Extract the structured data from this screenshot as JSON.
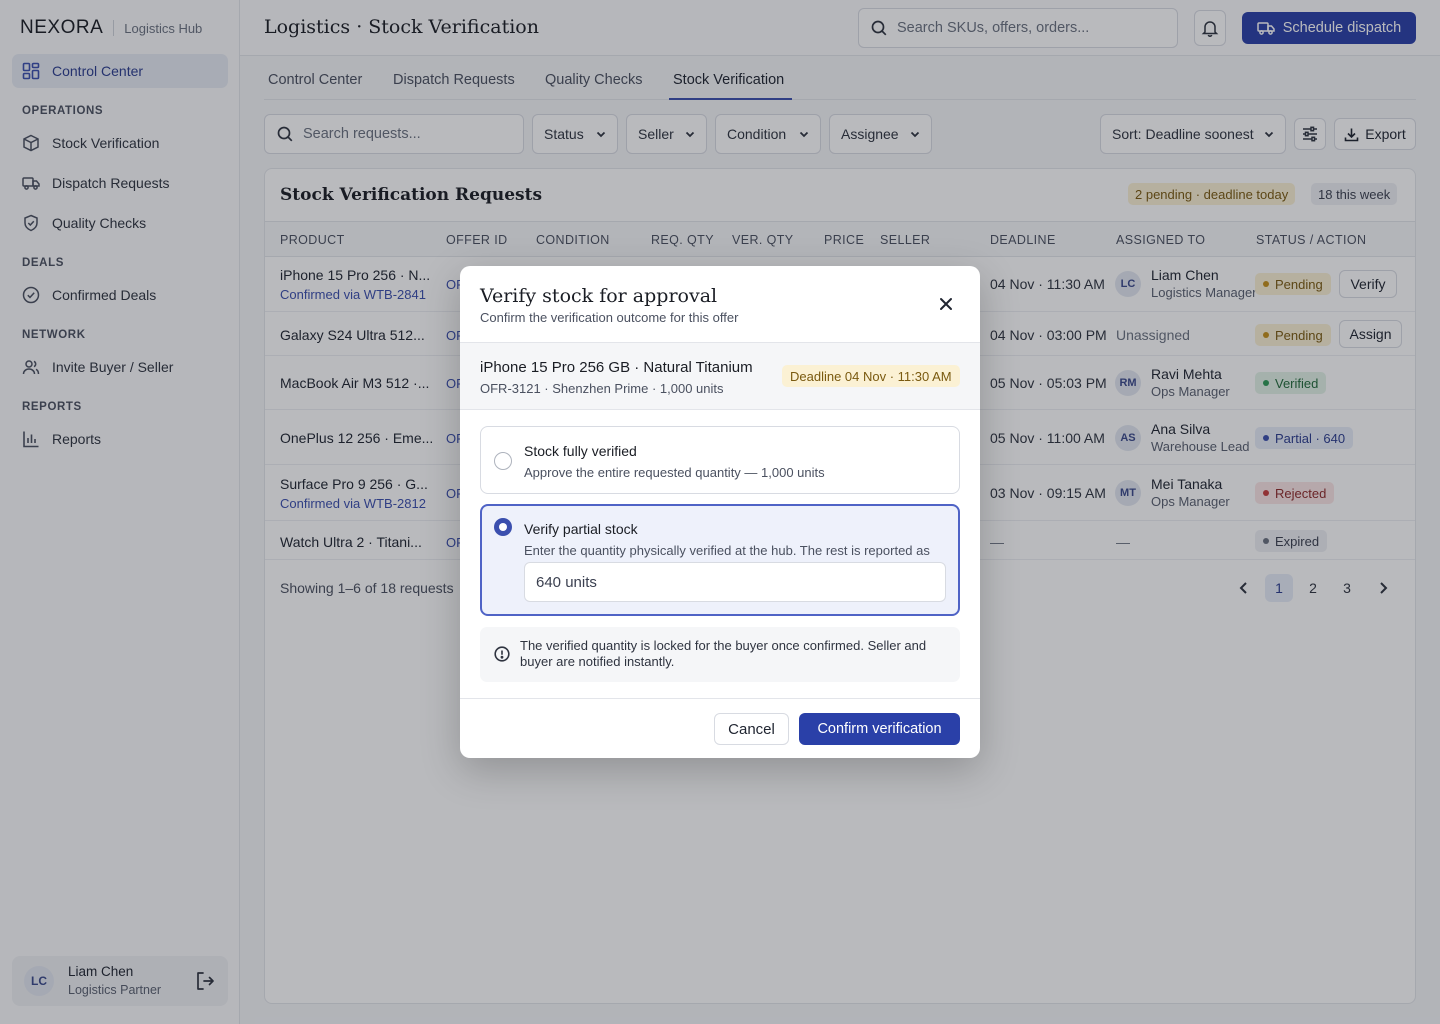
{
  "sidebar": {
    "brand": "NEXORA",
    "brand_sub": "Logistics Hub",
    "active_item": "Control Center",
    "sections": [
      {
        "label": "OPERATIONS",
        "items": [
          "Stock Verification",
          "Dispatch Requests",
          "Quality Checks"
        ]
      },
      {
        "label": "DEALS",
        "items": [
          "Confirmed Deals"
        ]
      },
      {
        "label": "NETWORK",
        "items": [
          "Invite Buyer / Seller"
        ]
      },
      {
        "label": "REPORTS",
        "items": [
          "Reports"
        ]
      }
    ],
    "user": {
      "initials": "LC",
      "name": "Liam Chen",
      "role": "Logistics Partner"
    }
  },
  "header": {
    "title": "Logistics · Stock Verification",
    "search_placeholder": "Search SKUs, offers, orders...",
    "dispatch_label": "Schedule dispatch"
  },
  "tabs": [
    {
      "label": "Control Center"
    },
    {
      "label": "Dispatch Requests"
    },
    {
      "label": "Quality Checks"
    },
    {
      "label": "Stock Verification",
      "active": true
    }
  ],
  "filters": {
    "search_placeholder": "Search requests...",
    "status": "Status",
    "seller": "Seller",
    "condition": "Condition",
    "assignee": "Assignee",
    "sort": "Sort: Deadline soonest",
    "export": "Export"
  },
  "panel": {
    "title": "Stock Verification Requests",
    "chip_pending": "2 pending · deadline today",
    "chip_week": "18 this week"
  },
  "table": {
    "columns": [
      "PRODUCT",
      "OFFER ID",
      "CONDITION",
      "REQ. QTY",
      "VER. QTY",
      "PRICE",
      "SELLER",
      "DEADLINE",
      "ASSIGNED TO",
      "STATUS / ACTION"
    ],
    "rows": [
      {
        "product": "iPhone 15 Pro 256 · N...",
        "sub": "Confirmed via WTB-2841",
        "offer": "OF",
        "deadline": "04 Nov · 11:30 AM",
        "initials": "LC",
        "assignee": "Liam Chen",
        "role": "Logistics Manager",
        "status": "Pending",
        "action": "Verify"
      },
      {
        "product": "Galaxy S24 Ultra 512...",
        "sub": "",
        "offer": "OF",
        "deadline": "04 Nov · 03:00 PM",
        "initials": "",
        "assignee": "Unassigned",
        "role": "",
        "status": "Pending",
        "action": "Assign"
      },
      {
        "product": "MacBook Air M3 512 ·...",
        "sub": "",
        "offer": "OF",
        "deadline": "05 Nov · 05:03 PM",
        "initials": "RM",
        "assignee": "Ravi Mehta",
        "role": "Ops Manager",
        "status": "Verified",
        "action": ""
      },
      {
        "product": "OnePlus 12 256 · Eme...",
        "sub": "",
        "offer": "OF",
        "deadline": "05 Nov · 11:00 AM",
        "initials": "AS",
        "assignee": "Ana Silva",
        "role": "Warehouse Lead",
        "status": "Partial · 640",
        "action": ""
      },
      {
        "product": "Surface Pro 9 256 · G...",
        "sub": "Confirmed via WTB-2812",
        "offer": "OF",
        "deadline": "03 Nov · 09:15 AM",
        "initials": "MT",
        "assignee": "Mei Tanaka",
        "role": "Ops Manager",
        "status": "Rejected",
        "action": ""
      },
      {
        "product": "Watch Ultra 2 · Titani...",
        "sub": "",
        "offer": "OF",
        "deadline": "—",
        "initials": "",
        "assignee": "—",
        "role": "",
        "status": "Expired",
        "action": ""
      }
    ]
  },
  "pagination": {
    "info": "Showing 1–6 of 18 requests",
    "pages": [
      "1",
      "2",
      "3"
    ],
    "current": "1"
  },
  "colors": {
    "primary": "#2a40a8",
    "accent": "#3b4fae",
    "pending": "#c5901a",
    "verified": "#2e9a56",
    "rejected": "#c63d3d"
  },
  "modal": {
    "title": "Verify stock for approval",
    "subtitle": "Confirm the verification outcome for this offer",
    "product": "iPhone 15 Pro 256 GB · Natural Titanium",
    "product_sub": "OFR-3121 · Shenzhen Prime · 1,000 units",
    "deadline": "Deadline 04 Nov · 11:30 AM",
    "option_full_title": "Stock fully verified",
    "option_full_desc": "Approve the entire requested quantity — 1,000 units",
    "option_partial_title": "Verify partial stock",
    "option_partial_desc": "Enter the quantity physically verified at the hub. The rest is reported as",
    "quantity_value": "640 units",
    "note": "The verified quantity is locked for the buyer once confirmed. Seller and buyer are notified instantly.",
    "cancel": "Cancel",
    "confirm": "Confirm verification"
  }
}
